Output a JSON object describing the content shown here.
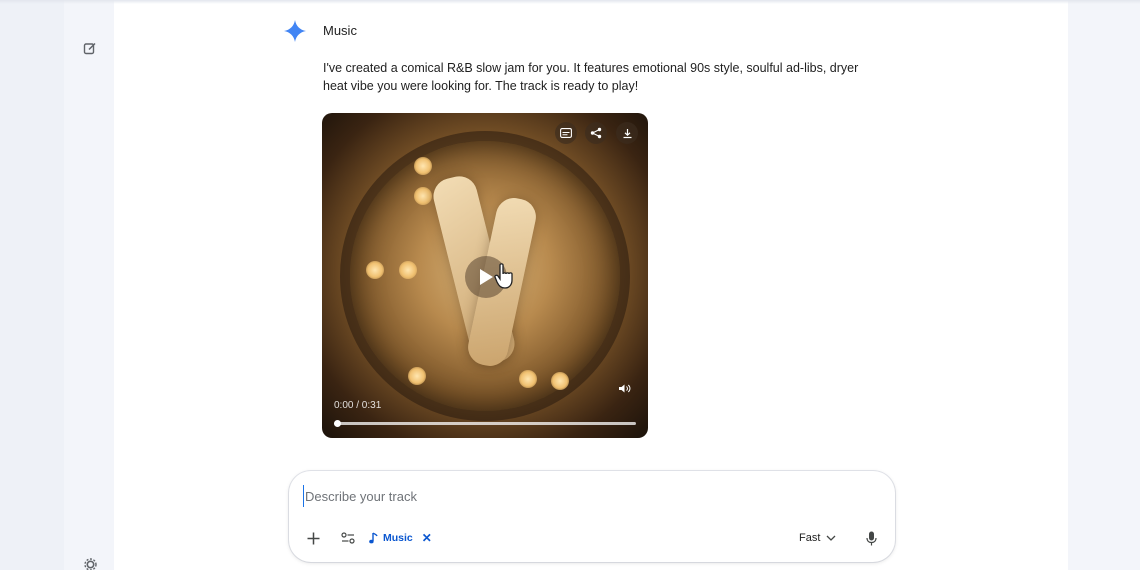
{
  "sidebar": {
    "icons": [
      "new-chat-icon",
      "settings-icon"
    ]
  },
  "message": {
    "model_name": "Music",
    "response_text": "I've created a comical R&B slow jam for you. It features emotional 90s style, soulful ad-libs, dryer heat vibe you were looking for. The track is ready to play!"
  },
  "player": {
    "time": "0:00 / 0:31",
    "progress": 0,
    "controls": [
      "captions-icon",
      "share-icon",
      "download-icon"
    ]
  },
  "composer": {
    "placeholder": "Describe your track",
    "value": "",
    "chip_label": "Music",
    "mode": "Fast"
  },
  "colors": {
    "accent": "#0b57d0",
    "sparkle": "#4285f4"
  }
}
